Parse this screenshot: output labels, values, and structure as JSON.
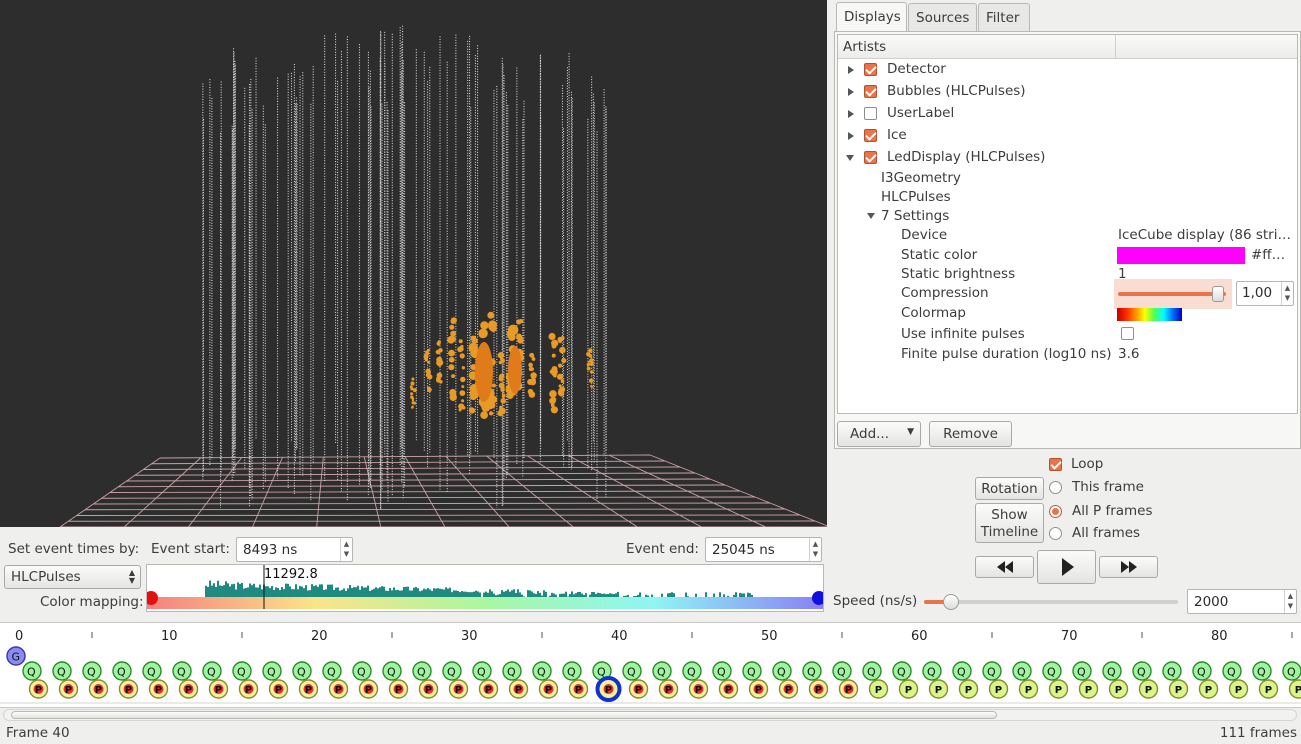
{
  "tabs": [
    {
      "label": "Displays"
    },
    {
      "label": "Sources"
    },
    {
      "label": "Filter"
    }
  ],
  "artists": {
    "header": "Artists",
    "items": [
      {
        "label": "Detector",
        "checked": true,
        "expanded": false
      },
      {
        "label": "Bubbles (HLCPulses)",
        "checked": true,
        "expanded": false
      },
      {
        "label": "UserLabel",
        "checked": false,
        "expanded": false
      },
      {
        "label": "Ice",
        "checked": true,
        "expanded": false
      },
      {
        "label": "LedDisplay (HLCPulses)",
        "checked": true,
        "expanded": true
      }
    ],
    "keys": [
      "I3Geometry",
      "HLCPulses"
    ],
    "settings_label": "7 Settings",
    "settings": {
      "device_label": "Device",
      "device_value": "IceCube display (86 stri…",
      "static_color_label": "Static color",
      "static_color_value": "#ff…",
      "static_color": "#ff00ff",
      "brightness_label": "Static brightness",
      "brightness_value": "1",
      "compression_label": "Compression",
      "compression_value": "1,00",
      "compression_level": 1.0,
      "colormap_label": "Colormap",
      "infinite_label": "Use infinite pulses",
      "infinite_checked": false,
      "duration_label": "Finite pulse duration (log10 ns)",
      "duration_value": "3.6"
    },
    "add_label": "Add...",
    "remove_label": "Remove"
  },
  "playback": {
    "loop_label": "Loop",
    "loop_checked": true,
    "rotation_label": "Rotation",
    "show_timeline_label": "Show Timeline",
    "this_frame_label": "This frame",
    "all_p_label": "All P frames",
    "all_frames_label": "All frames",
    "selected_mode": "all_p",
    "speed_label": "Speed (ns/s)",
    "speed_value": "2000"
  },
  "event_times": {
    "set_by_label": "Set event times by:",
    "source_value": "HLCPulses",
    "start_label": "Event start:",
    "start_value": "8493 ns",
    "end_label": "Event end:",
    "end_value": "25045 ns",
    "marker_value": "11292.8",
    "color_mapping_label": "Color mapping:"
  },
  "timeline": {
    "ticks": [
      "0",
      "10",
      "20",
      "30",
      "40",
      "50",
      "60",
      "70",
      "80"
    ],
    "g_label": "G",
    "q_label": "Q",
    "p_label": "P",
    "frame_label": "Frame 40",
    "frames_count": "111 frames",
    "current_frame": 40,
    "visible_frames": 85
  },
  "colors": {
    "accent": "#e9734a",
    "hit": "#e89a26",
    "p_badge": "#e63030",
    "q_fill": "#9ff59f"
  }
}
